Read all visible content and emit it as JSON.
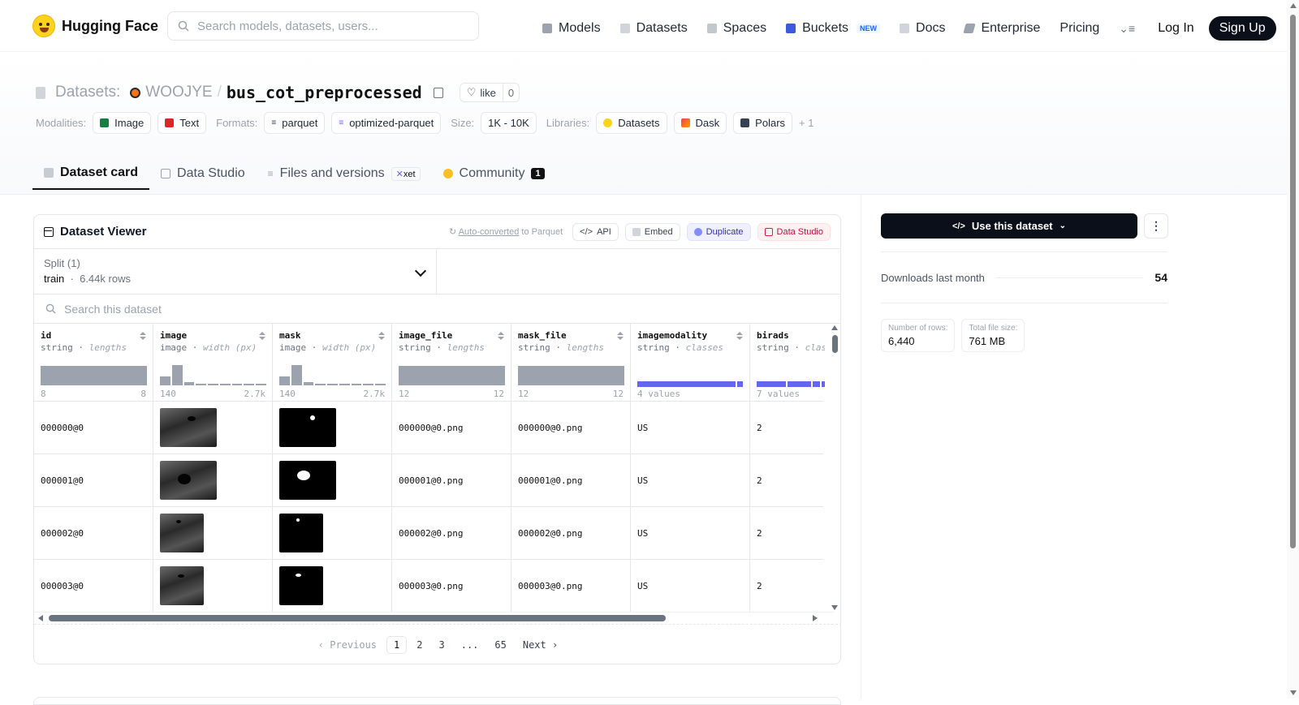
{
  "nav": {
    "brand": "Hugging Face",
    "search_placeholder": "Search models, datasets, users...",
    "links": [
      {
        "label": "Models",
        "icon": "cube-icon"
      },
      {
        "label": "Datasets",
        "icon": "database-icon"
      },
      {
        "label": "Spaces",
        "icon": "grid-icon"
      },
      {
        "label": "Buckets",
        "icon": "bucket-icon",
        "badge": "NEW"
      },
      {
        "label": "Docs",
        "icon": "book-icon"
      },
      {
        "label": "Enterprise",
        "icon": "enterprise-icon"
      },
      {
        "label": "Pricing"
      }
    ],
    "login": "Log In",
    "signup": "Sign Up"
  },
  "header": {
    "prefix": "Datasets:",
    "owner": "WOOJYE",
    "separator": "/",
    "repo": "bus_cot_preprocessed",
    "like_label": "like",
    "like_count": "0",
    "modalities_label": "Modalities:",
    "modalities": [
      "Image",
      "Text"
    ],
    "formats_label": "Formats:",
    "formats": [
      "parquet",
      "optimized-parquet"
    ],
    "size_label": "Size:",
    "size": "1K - 10K",
    "libraries_label": "Libraries:",
    "libraries": [
      "Datasets",
      "Dask",
      "Polars"
    ],
    "libraries_more": "+ 1"
  },
  "tabs": [
    {
      "label": "Dataset card",
      "active": true
    },
    {
      "label": "Data Studio"
    },
    {
      "label": "Files and versions",
      "badge": "xet"
    },
    {
      "label": "Community",
      "count": "1"
    }
  ],
  "viewer": {
    "title": "Dataset Viewer",
    "auto_converted_link": "Auto-converted",
    "auto_converted_rest": " to Parquet",
    "buttons": [
      "API",
      "Embed",
      "Duplicate",
      "Data Studio"
    ],
    "split_label": "Split (1)",
    "split_value": "train",
    "split_rows": "6.44k rows",
    "search_placeholder": "Search this dataset",
    "columns": [
      {
        "name": "id",
        "type": "string",
        "stat": "lengths",
        "min": "8",
        "max": "8"
      },
      {
        "name": "image",
        "type": "image",
        "stat": "width (px)",
        "min": "140",
        "max": "2.7k",
        "hist": [
          0.4,
          0.9,
          0.15,
          0.06,
          0.05,
          0.04,
          0.04,
          0.03,
          0.03
        ]
      },
      {
        "name": "mask",
        "type": "image",
        "stat": "width (px)",
        "min": "140",
        "max": "2.7k",
        "hist": [
          0.4,
          0.9,
          0.15,
          0.06,
          0.05,
          0.04,
          0.04,
          0.03,
          0.03
        ]
      },
      {
        "name": "image_file",
        "type": "string",
        "stat": "lengths",
        "min": "12",
        "max": "12"
      },
      {
        "name": "mask_file",
        "type": "string",
        "stat": "lengths",
        "min": "12",
        "max": "12"
      },
      {
        "name": "imagemodality",
        "type": "string",
        "stat": "classes",
        "min": "4 values",
        "max": ""
      },
      {
        "name": "birads",
        "type": "string",
        "stat": "clas",
        "min": "7 values",
        "max": ""
      }
    ],
    "rows": [
      {
        "id": "000000@0",
        "image_file": "000000@0.png",
        "mask_file": "000000@0.png",
        "imagemodality": "US",
        "birads": "2"
      },
      {
        "id": "000001@0",
        "image_file": "000001@0.png",
        "mask_file": "000001@0.png",
        "imagemodality": "US",
        "birads": "2"
      },
      {
        "id": "000002@0",
        "image_file": "000002@0.png",
        "mask_file": "000002@0.png",
        "imagemodality": "US",
        "birads": "2"
      },
      {
        "id": "000003@0",
        "image_file": "000003@0.png",
        "mask_file": "000003@0.png",
        "imagemodality": "US",
        "birads": "2"
      }
    ],
    "pager": {
      "prev": "Previous",
      "pages": [
        "1",
        "2",
        "3",
        "...",
        "65"
      ],
      "current": "1",
      "next": "Next"
    }
  },
  "sidebar": {
    "use_button": "Use this dataset",
    "downloads_label": "Downloads last month",
    "downloads_value": "54",
    "rows_label": "Number of rows:",
    "rows_value": "6,440",
    "size_label": "Total file size:",
    "size_value": "761 MB"
  },
  "colors": {
    "accent": "#6366f1",
    "dark_button": "#0b0f19"
  }
}
